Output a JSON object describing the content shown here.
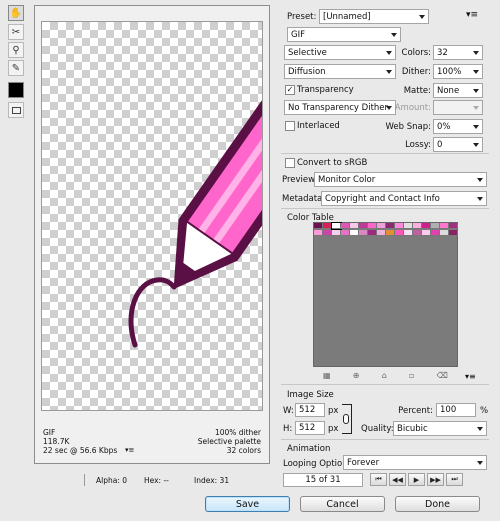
{
  "tools": [
    {
      "name": "hand-tool-icon",
      "glyph": "✋"
    },
    {
      "name": "slice-select-tool-icon",
      "glyph": "✂"
    },
    {
      "name": "zoom-tool-icon",
      "glyph": "⚲"
    },
    {
      "name": "eyedropper-tool-icon",
      "glyph": "✎"
    }
  ],
  "preview_info": {
    "format": "GIF",
    "size": "118.7K",
    "speed": "22 sec @ 56.6 Kbps",
    "dither": "100% dither",
    "palette": "Selective palette",
    "colors": "32 colors"
  },
  "status": {
    "alpha": "Alpha: 0",
    "hex": "Hex: --",
    "index": "Index: 31"
  },
  "settings": {
    "preset_label": "Preset:",
    "preset_value": "[Unnamed]",
    "format_value": "GIF",
    "reduction_value": "Selective",
    "colors_label": "Colors:",
    "colors_value": "32",
    "dither_algo_value": "Diffusion",
    "dither_label": "Dither:",
    "dither_value": "100%",
    "transparency_label": "Transparency",
    "matte_label": "Matte:",
    "matte_value": "None",
    "transparency_dither_value": "No Transparency Dither",
    "amount_label": "Amount:",
    "interlaced_label": "Interlaced",
    "websnap_label": "Web Snap:",
    "websnap_value": "0%",
    "lossy_label": "Lossy:",
    "lossy_value": "0",
    "convert_srgb_label": "Convert to sRGB",
    "preview_label": "Preview:",
    "preview_value": "Monitor Color",
    "metadata_label": "Metadata:",
    "metadata_value": "Copyright and Contact Info"
  },
  "color_table": {
    "title": "Color Table",
    "row1": [
      "#6b1050",
      "#d6205c",
      "#ffffff",
      "#e055b8",
      "#f7c8e8",
      "#c03898",
      "#ff66cc",
      "#f0a0d8",
      "#8a2a70",
      "#ff88dd",
      "#e0e0e0",
      "#ffb0e0",
      "#d02090",
      "#b0b0b0",
      "#ff77cc",
      "#a03080"
    ],
    "row2": [
      "#ff99dd",
      "#cc44aa",
      "#f4d0ea",
      "#e870c8",
      "#ffffff",
      "#d888c0",
      "#9c2a80",
      "#f0b0e0",
      "#e09030",
      "#ff55bb",
      "#f8e0f0",
      "#c060a0",
      "#ffcaf0",
      "#e040b0",
      "#dcdcdc",
      "#882266"
    ]
  },
  "image_size": {
    "title": "Image Size",
    "w_label": "W:",
    "w_value": "512",
    "w_unit": "px",
    "h_label": "H:",
    "h_value": "512",
    "h_unit": "px",
    "percent_label": "Percent:",
    "percent_value": "100",
    "percent_unit": "%",
    "quality_label": "Quality:",
    "quality_value": "Bicubic"
  },
  "animation": {
    "title": "Animation",
    "looping_label": "Looping Options:",
    "looping_value": "Forever",
    "frame_counter": "15 of 31"
  },
  "buttons": {
    "save": "Save",
    "cancel": "Cancel",
    "done": "Done"
  },
  "colors": {
    "accent": "#3c7fb1",
    "pencil_outline": "#5a0f45",
    "pencil_body": "#ff66cc",
    "pencil_light": "#ffb3e6",
    "swatch_fg": "#000000"
  }
}
